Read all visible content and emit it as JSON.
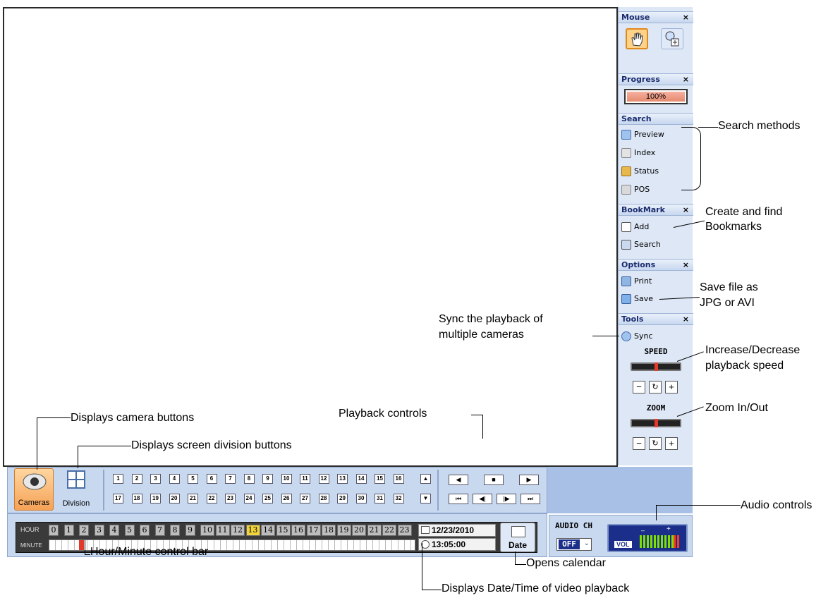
{
  "panel": {
    "mouse": {
      "title": "Mouse",
      "close": "×"
    },
    "progress": {
      "title": "Progress",
      "close": "×",
      "value_text": "100%"
    },
    "search": {
      "title": "Search",
      "items": [
        "Preview",
        "Index",
        "Status",
        "POS"
      ]
    },
    "bookmark": {
      "title": "BookMark",
      "close": "×",
      "items": [
        "Add",
        "Search"
      ]
    },
    "options": {
      "title": "Options",
      "close": "×",
      "items": [
        "Print",
        "Save"
      ]
    },
    "tools": {
      "title": "Tools",
      "close": "×",
      "items": [
        "Sync"
      ],
      "speed_label": "SPEED",
      "zoom_label": "ZOOM"
    }
  },
  "bottom": {
    "cameras_label": "Cameras",
    "division_label": "Division",
    "channels_row1": [
      "1",
      "2",
      "3",
      "4",
      "5",
      "6",
      "7",
      "8",
      "9",
      "10",
      "11",
      "12",
      "13",
      "14",
      "15",
      "16"
    ],
    "channels_row2": [
      "17",
      "18",
      "19",
      "20",
      "21",
      "22",
      "23",
      "24",
      "25",
      "26",
      "27",
      "28",
      "29",
      "30",
      "31",
      "32"
    ],
    "hour_label": "HOUR",
    "minute_label": "MINUTE",
    "hours": [
      "0",
      "1",
      "2",
      "3",
      "4",
      "5",
      "6",
      "7",
      "8",
      "9",
      "10",
      "11",
      "12",
      "13",
      "14",
      "15",
      "16",
      "17",
      "18",
      "19",
      "20",
      "21",
      "22",
      "23"
    ],
    "selected_hour": "13",
    "date": "12/23/2010",
    "time": "13:05:00",
    "date_button": "Date",
    "audio_label": "AUDIO CH",
    "audio_value": "OFF",
    "vol_label": "VOL",
    "vol_minus": "–",
    "vol_plus": "+"
  },
  "annotations": {
    "search_methods": "Search methods",
    "create_bookmarks_1": "Create and find",
    "create_bookmarks_2": "Bookmarks",
    "save_file_1": "Save file as",
    "save_file_2": "JPG or AVI",
    "sync_1": "Sync the playback of",
    "sync_2": "multiple cameras",
    "speed_1": "Increase/Decrease",
    "speed_2": "playback speed",
    "zoom": "Zoom In/Out",
    "cameras": "Displays camera buttons",
    "division": "Displays screen division buttons",
    "playback": "Playback controls",
    "audio": "Audio controls",
    "hour_minute": "Hour/Minute control bar",
    "calendar": "Opens calendar",
    "date_time": "Displays Date/Time of video playback"
  }
}
